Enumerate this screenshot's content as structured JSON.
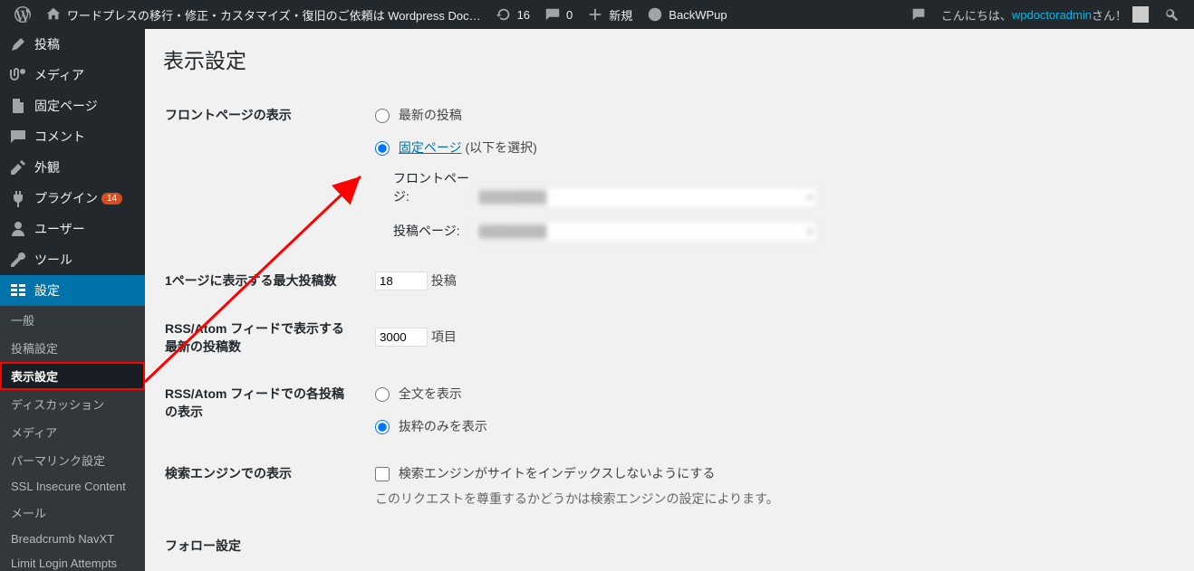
{
  "adminbar": {
    "site_title": "ワードプレスの移行・修正・カスタマイズ・復旧のご依頼は Wordpress Doc…",
    "update_count": "16",
    "comment_count": "0",
    "new_label": "新規",
    "backwpup_label": "BackWPup",
    "greeting_prefix": "こんにちは、",
    "greeting_user": "wpdoctoradmin",
    "greeting_suffix": " さん！"
  },
  "menu": {
    "posts": "投稿",
    "media": "メディア",
    "pages": "固定ページ",
    "comments": "コメント",
    "appearance": "外観",
    "plugins": "プラグイン",
    "plugins_badge": "14",
    "users": "ユーザー",
    "tools": "ツール",
    "settings": "設定",
    "sub": {
      "general": "一般",
      "writing": "投稿設定",
      "reading": "表示設定",
      "discussion": "ディスカッション",
      "media": "メディア",
      "permalink": "パーマリンク設定",
      "ssl": "SSL Insecure Content",
      "mail": "メール",
      "breadcrumb": "Breadcrumb NavXT",
      "lla": "Limit Login Attempts"
    }
  },
  "page": {
    "title": "表示設定",
    "frontpage_heading": "フロントページの表示",
    "frontpage_opt_latest": "最新の投稿",
    "frontpage_opt_static_link": "固定ページ",
    "frontpage_opt_static_tail": " (以下を選択)",
    "front_label": "フロントページ:",
    "posts_label": "投稿ページ:",
    "posts_per_page_heading": "1ページに表示する最大投稿数",
    "posts_per_page_value": "18",
    "posts_per_page_unit": "投稿",
    "rss_count_heading": "RSS/Atom フィードで表示する最新の投稿数",
    "rss_count_value": "3000",
    "rss_count_unit": "項目",
    "rss_fmt_heading": "RSS/Atom フィードでの各投稿の表示",
    "rss_fmt_full": "全文を表示",
    "rss_fmt_excerpt": "抜粋のみを表示",
    "seo_heading": "検索エンジンでの表示",
    "seo_checkbox": "検索エンジンがサイトをインデックスしないようにする",
    "seo_desc": "このリクエストを尊重するかどうかは検索エンジンの設定によります。",
    "follow_heading": "フォロー設定"
  }
}
